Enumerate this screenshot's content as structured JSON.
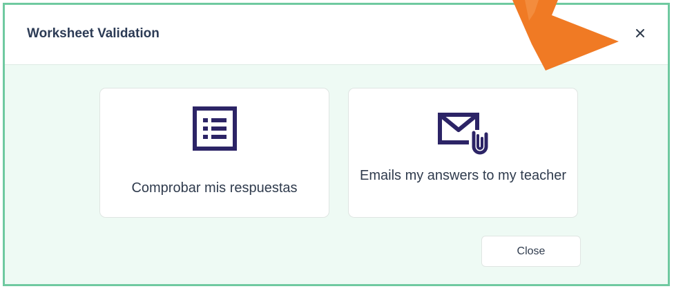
{
  "dialog": {
    "title": "Worksheet Validation",
    "close_icon": "close-icon"
  },
  "options": [
    {
      "label": "Comprobar mis respuestas",
      "icon": "list-icon"
    },
    {
      "label": "Emails my answers to my teacher",
      "icon": "email-attachment-icon"
    }
  ],
  "footer": {
    "close_label": "Close"
  },
  "colors": {
    "border": "#6fc9a0",
    "body_background": "#eefaf4",
    "icon_color": "#2c2466",
    "title_color": "#2c3b55",
    "arrow": "#f07a24"
  },
  "annotation": {
    "arrow_icon": "pointer-arrow-icon"
  }
}
